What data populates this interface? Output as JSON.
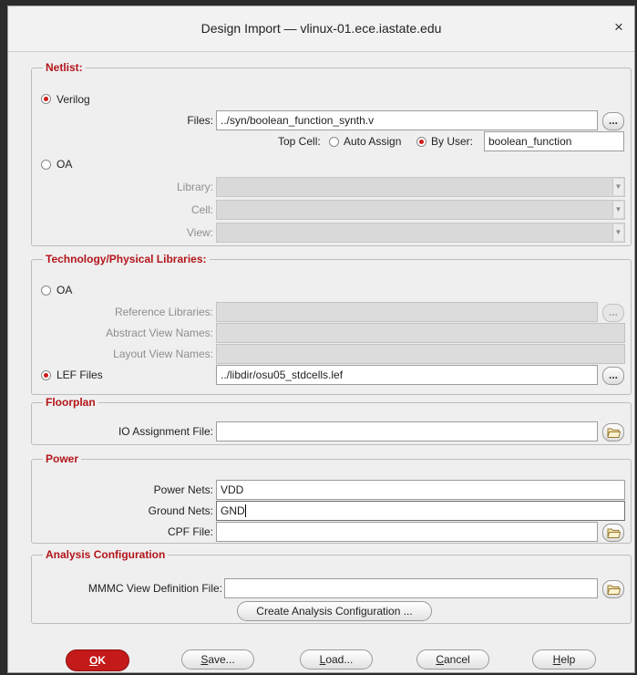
{
  "window": {
    "title": "Design Import — vlinux-01.ece.iastate.edu",
    "close_glyph": "×"
  },
  "netlist": {
    "legend": "Netlist:",
    "verilog_label": "Verilog",
    "files_label": "Files:",
    "files_value": "../syn/boolean_function_synth.v",
    "browse_label": "...",
    "top_cell_label": "Top Cell:",
    "auto_assign_label": "Auto Assign",
    "by_user_label": "By User:",
    "top_cell_value": "boolean_function",
    "oa_label": "OA",
    "library_label": "Library:",
    "cell_label": "Cell:",
    "view_label": "View:",
    "selected": "Verilog",
    "top_cell_mode": "By User"
  },
  "tech": {
    "legend": "Technology/Physical Libraries:",
    "oa_label": "OA",
    "ref_libs_label": "Reference Libraries:",
    "abstract_label": "Abstract View Names:",
    "layout_label": "Layout View Names:",
    "lef_label": "LEF Files",
    "lef_value": "../libdir/osu05_stdcells.lef",
    "browse_label": "...",
    "selected": "LEF Files"
  },
  "floorplan": {
    "legend": "Floorplan",
    "io_label": "IO Assignment File:",
    "io_value": "",
    "folder_icon": "folder-open-icon"
  },
  "power": {
    "legend": "Power",
    "power_nets_label": "Power Nets:",
    "power_nets_value": "VDD",
    "ground_nets_label": "Ground Nets:",
    "ground_nets_value": "GND",
    "cpf_label": "CPF File:",
    "cpf_value": ""
  },
  "analysis": {
    "legend": "Analysis Configuration",
    "mmmc_label": "MMMC View Definition File:",
    "mmmc_value": "",
    "create_label": "Create Analysis Configuration ..."
  },
  "buttons": {
    "ok": {
      "first": "O",
      "rest": "K"
    },
    "save": {
      "first": "S",
      "rest": "ave..."
    },
    "load": {
      "first": "L",
      "rest": "oad..."
    },
    "cancel": {
      "first": "C",
      "rest": "ancel"
    },
    "help": {
      "first": "H",
      "rest": "elp"
    }
  },
  "colors": {
    "accent": "#c41a1a",
    "legend": "#b3151a",
    "radio_on": "#d01818"
  }
}
